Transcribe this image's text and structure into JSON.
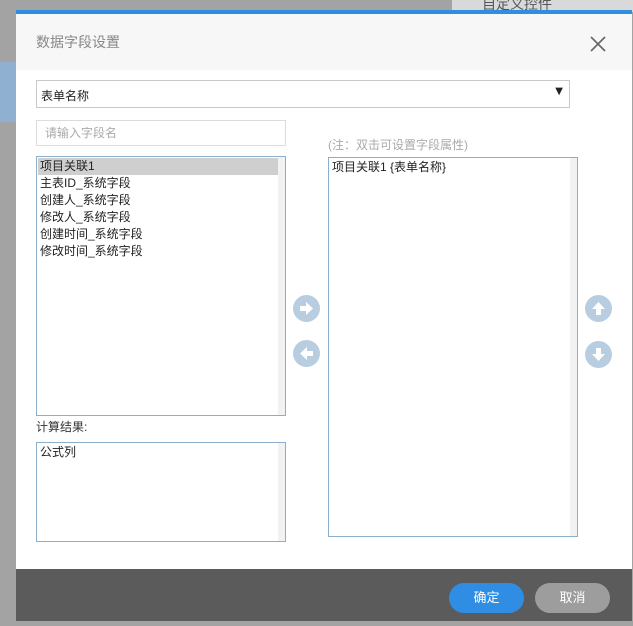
{
  "background": {
    "tab_label": "自定义控件"
  },
  "dialog": {
    "title": "数据字段设置",
    "accent_color": "#2f8de4",
    "close_icon": "close-icon"
  },
  "form_select": {
    "selected": "表单名称"
  },
  "search": {
    "placeholder": "请输入字段名",
    "value": ""
  },
  "note": "(注：双击可设置字段属性)",
  "field_list": {
    "items": [
      {
        "label": "项目关联1",
        "selected": true
      },
      {
        "label": "主表ID_系统字段",
        "selected": false
      },
      {
        "label": "创建人_系统字段",
        "selected": false
      },
      {
        "label": "修改人_系统字段",
        "selected": false
      },
      {
        "label": "创建时间_系统字段",
        "selected": false
      },
      {
        "label": "修改时间_系统字段",
        "selected": false
      }
    ]
  },
  "calc": {
    "label": "计算结果:",
    "items": [
      {
        "label": "公式列"
      }
    ]
  },
  "selected_fields": {
    "items": [
      {
        "label": "项目关联1 {表单名称}"
      }
    ]
  },
  "transfer_buttons": {
    "add_icon": "arrow-right-circle-icon",
    "remove_icon": "arrow-left-circle-icon",
    "up_icon": "arrow-up-circle-icon",
    "down_icon": "arrow-down-circle-icon",
    "color": "#b8cde0"
  },
  "footer": {
    "ok_label": "确定",
    "cancel_label": "取消",
    "ok_color": "#2f8de4",
    "cancel_color": "#9d9d9d"
  }
}
